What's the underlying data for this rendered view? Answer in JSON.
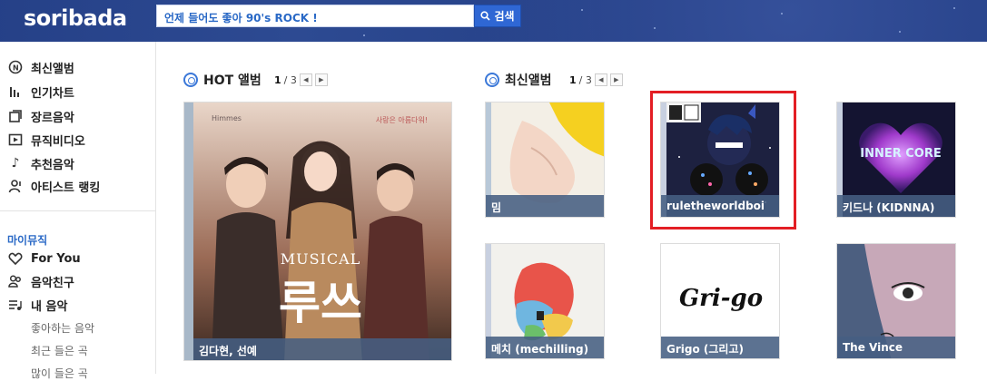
{
  "header": {
    "logo": "soribada",
    "search_value": "언제 들어도 좋아 90's ROCK !",
    "search_button": "검색"
  },
  "sidebar": {
    "menu": [
      {
        "label": "최신앨범",
        "icon": "new-album-icon"
      },
      {
        "label": "인기차트",
        "icon": "chart-icon"
      },
      {
        "label": "장르음악",
        "icon": "genre-icon"
      },
      {
        "label": "뮤직비디오",
        "icon": "video-icon"
      },
      {
        "label": "추천음악",
        "icon": "music-note-icon"
      },
      {
        "label": "아티스트 랭킹",
        "icon": "artist-icon"
      }
    ],
    "my_music_title": "마이뮤직",
    "my_menu": [
      {
        "label": "For You",
        "icon": "heart-icon"
      },
      {
        "label": "음악친구",
        "icon": "friends-icon"
      },
      {
        "label": "내 음악",
        "icon": "playlist-icon"
      }
    ],
    "sub_menu": [
      "좋아하는 음악",
      "최근 들은 곡",
      "많이 들은 곡"
    ]
  },
  "hot": {
    "title": "HOT 앨범",
    "page": "1",
    "total": "/ 3",
    "album": {
      "caption": "김다현, 선예",
      "cover_title": "MUSICAL",
      "cover_big": "루쓰",
      "cover_small": "사랑은 아름다워!",
      "cover_brand": "Himmes"
    }
  },
  "new": {
    "title": "최신앨범",
    "page": "1",
    "total": "/ 3",
    "albums": [
      {
        "caption": "밈"
      },
      {
        "caption": "ruletheworldboi"
      },
      {
        "caption": "키드나 (KIDNNA)",
        "cover_text": "INNER CORE"
      },
      {
        "caption": "메치 (mechilling)"
      },
      {
        "caption": "Grigo (그리고)",
        "cover_text": "Gri-go"
      },
      {
        "caption": "The Vince"
      }
    ]
  },
  "colors": {
    "header": "#243f86",
    "accent": "#2a69c6",
    "highlight": "#e31e24",
    "caption_bg": "#465f82"
  }
}
